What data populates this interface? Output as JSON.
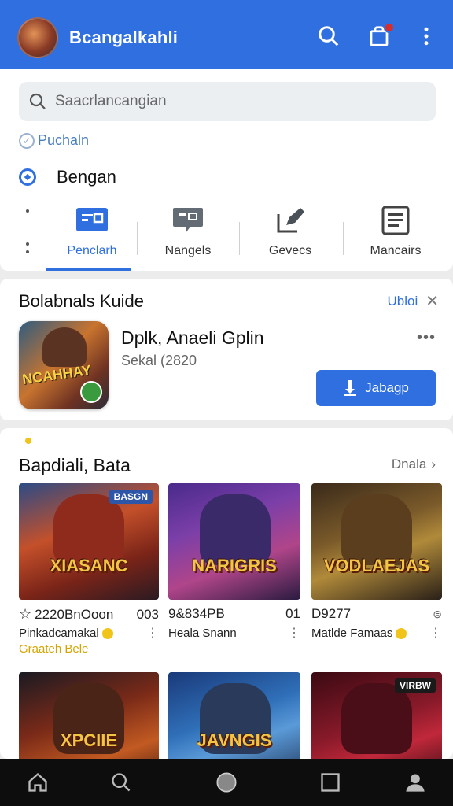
{
  "appbar": {
    "title": "Bcangalkahli",
    "avatar_icon": "game-avatar",
    "icons": [
      "search-icon",
      "bag-icon",
      "more-vert-icon"
    ],
    "accent": "#2f6fe0"
  },
  "search": {
    "placeholder": "Saacrlancangian"
  },
  "breadcrumb": {
    "label": "Puchaln"
  },
  "section": {
    "label": "Bengan"
  },
  "tabs": [
    {
      "label": "Penclarh",
      "icon": "monitor-icon",
      "active": true
    },
    {
      "label": "Nangels",
      "icon": "chat-icon",
      "active": false
    },
    {
      "label": "Gevecs",
      "icon": "edit-icon",
      "active": false
    },
    {
      "label": "Mancairs",
      "icon": "list-icon",
      "active": false
    }
  ],
  "featured": {
    "title": "Bolabnals Kuide",
    "link": "Ubloi",
    "app_name": "Dplk, Anaeli Gplin",
    "app_sub": "Sekal (2820",
    "icon_text": "NCAHHAY",
    "button": "Jabagp"
  },
  "list": {
    "title": "Bapdiali, Bata",
    "more": "Dnala",
    "items": [
      {
        "art": "XIASANC",
        "tag": "BASGN",
        "line1_left": "2220BnOoon",
        "line1_right": "003",
        "line2": "Pinkadcamakal",
        "line3": "Graateh Bele"
      },
      {
        "art": "NARIGRIS",
        "tag": "",
        "line1_left": "9&834PB",
        "line1_right": "01",
        "line2": "Heala Snann",
        "line3": ""
      },
      {
        "art": "VODLAEJAS",
        "tag": "",
        "line1_left": "D9277",
        "line1_right": "",
        "line2": "Matlde Famaas",
        "line3": ""
      },
      {
        "art": "XPCIIE",
        "tag": "",
        "line1_left": "",
        "line1_right": "",
        "line2": "",
        "line3": ""
      },
      {
        "art": "JAVNGIS",
        "tag": "",
        "line1_left": "",
        "line1_right": "",
        "line2": "",
        "line3": ""
      },
      {
        "art": "",
        "tag": "VIRBW",
        "line1_left": "",
        "line1_right": "",
        "line2": "",
        "line3": ""
      }
    ]
  },
  "navbar": {
    "icons": [
      "home-icon",
      "search-icon",
      "circle-home-icon",
      "square-icon",
      "profile-icon"
    ]
  }
}
